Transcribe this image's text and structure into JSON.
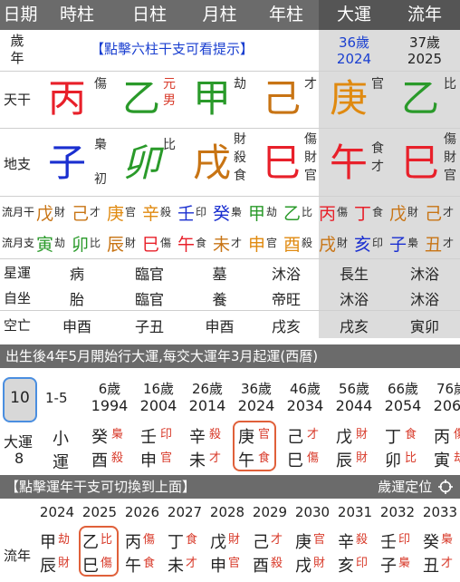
{
  "header": {
    "cols": [
      "日期",
      "時柱",
      "日柱",
      "月柱",
      "年柱",
      "大運",
      "流年"
    ]
  },
  "age_row": {
    "label": "歲年",
    "hint": "【點擊六柱干支可看提示】",
    "dayun_age": "36歲",
    "dayun_year": "2024",
    "liunian_age": "37歲",
    "liunian_year": "2025"
  },
  "tiangan": {
    "label": "天干",
    "pillars": [
      {
        "char": "丙",
        "god": "傷"
      },
      {
        "char": "乙",
        "god": "元",
        "god2": "男"
      },
      {
        "char": "甲",
        "god": "劫"
      },
      {
        "char": "己",
        "god": "才"
      },
      {
        "char": "庚",
        "god": "官"
      },
      {
        "char": "乙",
        "god": "比"
      }
    ]
  },
  "dizhi": {
    "label": "地支",
    "pillars": [
      {
        "char": "子",
        "hidden": [
          "梟"
        ],
        "note": "初"
      },
      {
        "char": "卯",
        "hidden": [
          "比"
        ]
      },
      {
        "char": "戌",
        "hidden": [
          "財",
          "殺",
          "食"
        ]
      },
      {
        "char": "巳",
        "hidden": [
          "傷",
          "財",
          "官"
        ]
      },
      {
        "char": "午",
        "hidden": [
          "食",
          "才"
        ]
      },
      {
        "char": "巳",
        "hidden": [
          "傷",
          "財",
          "官"
        ]
      }
    ]
  },
  "liuyue_gan": {
    "label": "流月干",
    "items": [
      [
        "戊",
        "財"
      ],
      [
        "己",
        "才"
      ],
      [
        "庚",
        "官"
      ],
      [
        "辛",
        "殺"
      ],
      [
        "壬",
        "印"
      ],
      [
        "癸",
        "梟"
      ],
      [
        "甲",
        "劫"
      ],
      [
        "乙",
        "比"
      ],
      [
        "丙",
        "傷"
      ],
      [
        "丁",
        "食"
      ],
      [
        "戊",
        "財"
      ],
      [
        "己",
        "才"
      ]
    ]
  },
  "liuyue_zhi": {
    "label": "流月支",
    "items": [
      [
        "寅",
        "劫"
      ],
      [
        "卯",
        "比"
      ],
      [
        "辰",
        "財"
      ],
      [
        "巳",
        "傷"
      ],
      [
        "午",
        "食"
      ],
      [
        "未",
        "才"
      ],
      [
        "申",
        "官"
      ],
      [
        "酉",
        "殺"
      ],
      [
        "戌",
        "財"
      ],
      [
        "亥",
        "印"
      ],
      [
        "子",
        "梟"
      ],
      [
        "丑",
        "才"
      ]
    ]
  },
  "xingyun": {
    "label": "星運",
    "values": [
      "病",
      "臨官",
      "墓",
      "沐浴",
      "長生",
      "沐浴"
    ]
  },
  "zizuo": {
    "label": "自坐",
    "values": [
      "胎",
      "臨官",
      "養",
      "帝旺",
      "沐浴",
      "沐浴"
    ]
  },
  "kongwang": {
    "label": "空亡",
    "values": [
      "申酉",
      "子丑",
      "申酉",
      "戌亥",
      "戌亥",
      "寅卯"
    ]
  },
  "dayun_bar": "出生後4年5月開始行大運,每交大運年3月起運(西曆)",
  "dayun": {
    "selected": "10",
    "range": "1-5",
    "label": "大運",
    "count": "8",
    "small_label": [
      "小",
      "運"
    ],
    "ages": [
      "6歲",
      "16歲",
      "26歲",
      "36歲",
      "46歲",
      "56歲",
      "66歲",
      "76歲"
    ],
    "years": [
      "1994",
      "2004",
      "2014",
      "2024",
      "2034",
      "2044",
      "2054",
      "2064"
    ],
    "gan": [
      [
        "癸",
        "梟"
      ],
      [
        "壬",
        "印"
      ],
      [
        "辛",
        "殺"
      ],
      [
        "庚",
        "官"
      ],
      [
        "己",
        "才"
      ],
      [
        "戊",
        "財"
      ],
      [
        "丁",
        "食"
      ],
      [
        "丙",
        "傷"
      ]
    ],
    "zhi": [
      [
        "酉",
        "殺"
      ],
      [
        "申",
        "官"
      ],
      [
        "未",
        "才"
      ],
      [
        "午",
        "食"
      ],
      [
        "巳",
        "傷"
      ],
      [
        "辰",
        "財"
      ],
      [
        "卯",
        "比"
      ],
      [
        "寅",
        "劫"
      ]
    ]
  },
  "liunian_bar": {
    "hint": "【點擊運年干支可切換到上面】",
    "locate": "歲運定位"
  },
  "liunian": {
    "label": "流年",
    "years": [
      "2024",
      "2025",
      "2026",
      "2027",
      "2028",
      "2029",
      "2030",
      "2031",
      "2032",
      "2033"
    ],
    "gan": [
      [
        "甲",
        "劫"
      ],
      [
        "乙",
        "比"
      ],
      [
        "丙",
        "傷"
      ],
      [
        "丁",
        "食"
      ],
      [
        "戊",
        "財"
      ],
      [
        "己",
        "才"
      ],
      [
        "庚",
        "官"
      ],
      [
        "辛",
        "殺"
      ],
      [
        "壬",
        "印"
      ],
      [
        "癸",
        "梟"
      ]
    ],
    "zhi": [
      [
        "辰",
        "財"
      ],
      [
        "巳",
        "傷"
      ],
      [
        "午",
        "食"
      ],
      [
        "未",
        "才"
      ],
      [
        "申",
        "官"
      ],
      [
        "酉",
        "殺"
      ],
      [
        "戌",
        "財"
      ],
      [
        "亥",
        "印"
      ],
      [
        "子",
        "梟"
      ],
      [
        "丑",
        "才"
      ]
    ]
  }
}
